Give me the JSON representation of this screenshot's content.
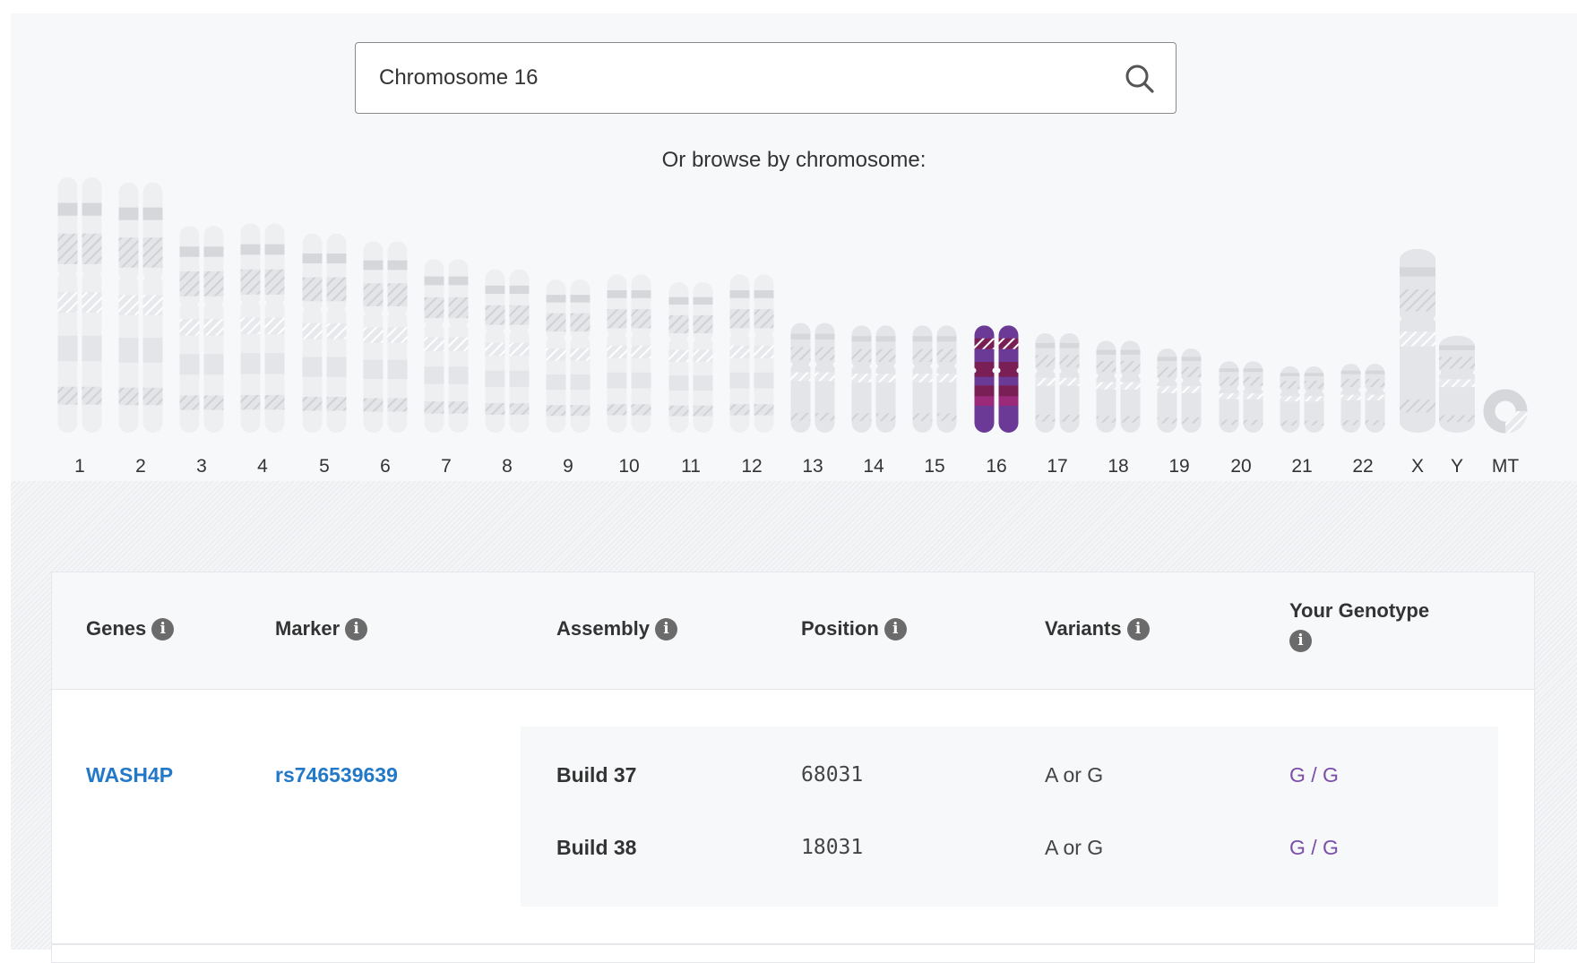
{
  "search": {
    "value": "Chromosome 16",
    "icon": "search-icon"
  },
  "browse_label": "Or browse by chromosome:",
  "chromosomes": {
    "selected": "16",
    "colors": {
      "inactive_light": "#eeeff1",
      "inactive_mid": "#e4e5e8",
      "inactive_dark": "#d6d7da",
      "selected_base": "#6b3a96",
      "selected_dark": "#7a1f56",
      "selected_band": "#9b2a7a"
    },
    "items": [
      {
        "label": "1",
        "size": 1.0
      },
      {
        "label": "2",
        "size": 0.98
      },
      {
        "label": "3",
        "size": 0.81
      },
      {
        "label": "4",
        "size": 0.82
      },
      {
        "label": "5",
        "size": 0.78
      },
      {
        "label": "6",
        "size": 0.75
      },
      {
        "label": "7",
        "size": 0.68
      },
      {
        "label": "8",
        "size": 0.64
      },
      {
        "label": "9",
        "size": 0.6
      },
      {
        "label": "10",
        "size": 0.62
      },
      {
        "label": "11",
        "size": 0.59
      },
      {
        "label": "12",
        "size": 0.62
      },
      {
        "label": "13",
        "size": 0.43
      },
      {
        "label": "14",
        "size": 0.42
      },
      {
        "label": "15",
        "size": 0.42
      },
      {
        "label": "16",
        "size": 0.42
      },
      {
        "label": "17",
        "size": 0.39
      },
      {
        "label": "18",
        "size": 0.36
      },
      {
        "label": "19",
        "size": 0.33
      },
      {
        "label": "20",
        "size": 0.28
      },
      {
        "label": "21",
        "size": 0.26
      },
      {
        "label": "22",
        "size": 0.27
      },
      {
        "label": "X",
        "size": 0.72
      },
      {
        "label": "Y",
        "size": 0.38
      },
      {
        "label": "MT",
        "size": 0.0
      }
    ]
  },
  "table": {
    "headers": [
      "Genes",
      "Marker",
      "Assembly",
      "Position",
      "Variants",
      "Your Genotype"
    ],
    "info_icon": "i",
    "rows": [
      {
        "gene": "WASH4P",
        "marker": "rs746539639",
        "builds": [
          {
            "assembly": "Build 37",
            "position": "68031",
            "variants": "A or G",
            "genotype": "G / G"
          },
          {
            "assembly": "Build 38",
            "position": "18031",
            "variants": "A or G",
            "genotype": "G / G"
          }
        ]
      }
    ]
  }
}
